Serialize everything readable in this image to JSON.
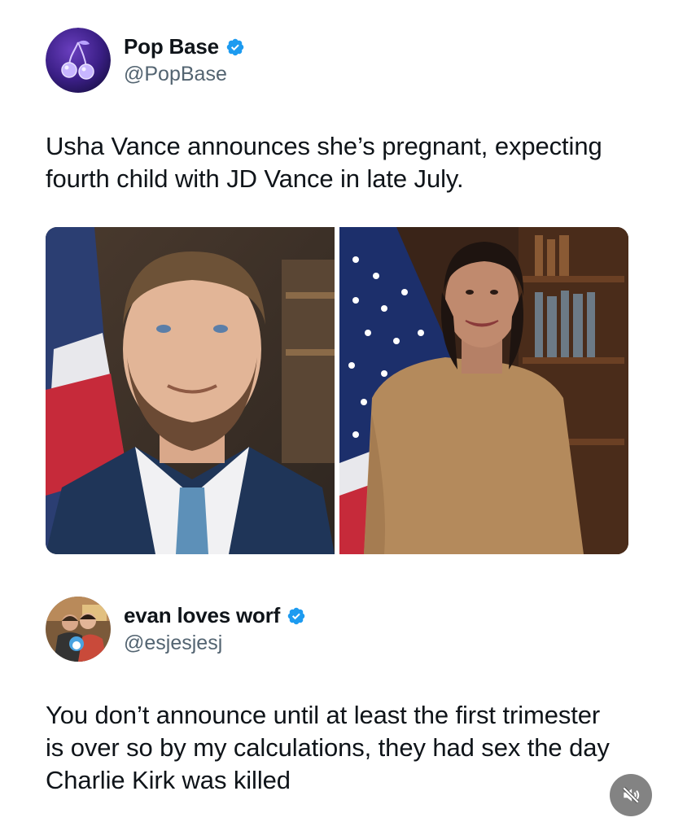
{
  "post": {
    "author": {
      "display_name": "Pop Base",
      "handle": "@PopBase",
      "verified": true,
      "avatar_icon": "cherries-icon"
    },
    "text_line1": "Usha Vance announces she’s pregnant, expecting",
    "text_line2": "fourth child with JD Vance in late July.",
    "media": [
      {
        "description_icon": "portrait-man-photo"
      },
      {
        "description_icon": "portrait-woman-photo"
      }
    ]
  },
  "reply": {
    "author": {
      "display_name": "evan loves worf",
      "handle": "@esjesjesj",
      "verified": true
    },
    "text_line1": "You don’t announce until at least the first trimester",
    "text_line2": "is over so by my calculations, they had sex the day",
    "text_line3": "Charlie Kirk was killed"
  },
  "controls": {
    "mute_icon": "speaker-muted-icon"
  },
  "colors": {
    "verified_blue": "#1d9bf0",
    "handle_gray": "#536471",
    "text": "#0f1419"
  }
}
